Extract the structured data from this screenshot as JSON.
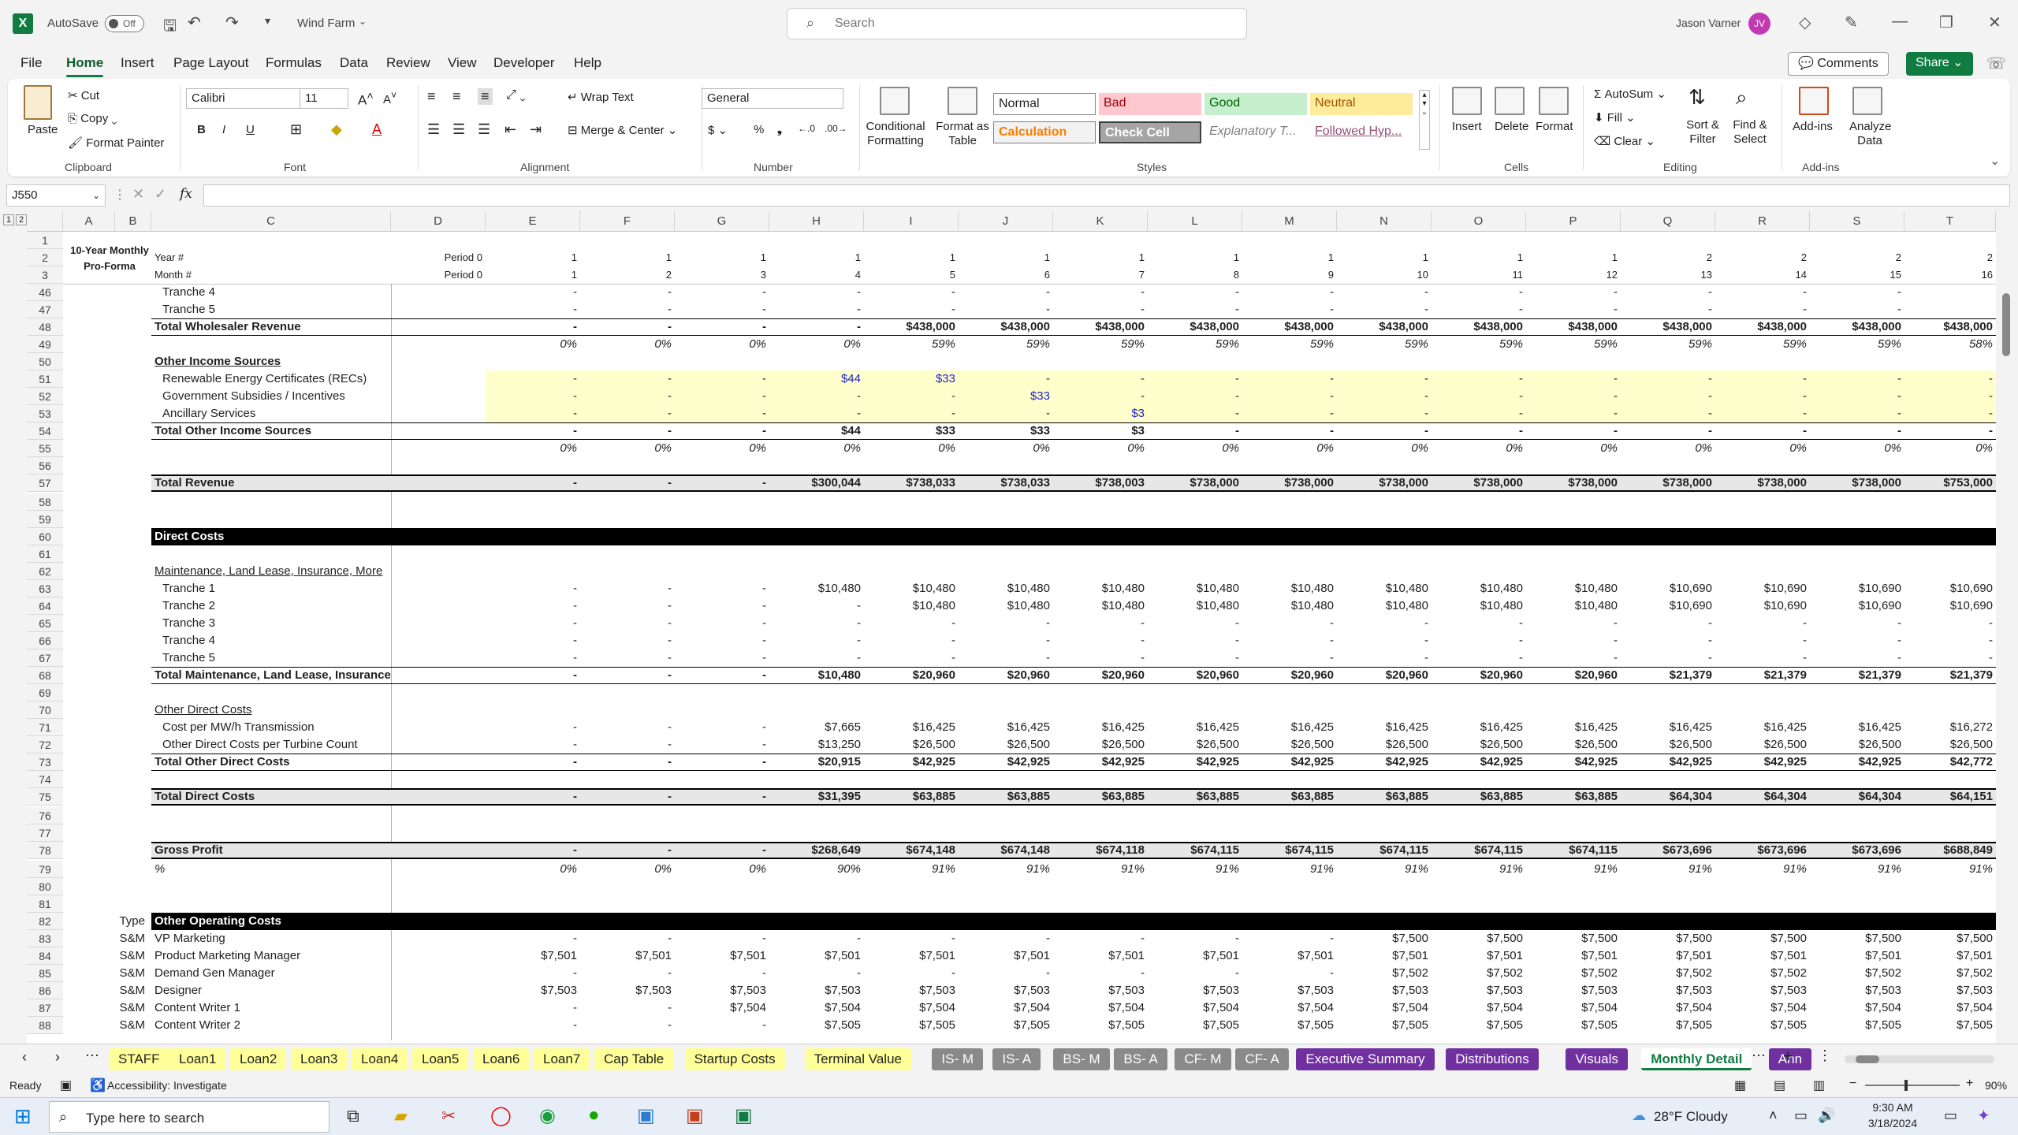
{
  "titlebar": {
    "autosave_label": "AutoSave",
    "autosave_state": "Off",
    "filename": "Wind Farm",
    "search_placeholder": "Search",
    "user_name": "Jason Varner",
    "user_initials": "JV"
  },
  "menu": [
    "File",
    "Home",
    "Insert",
    "Page Layout",
    "Formulas",
    "Data",
    "Review",
    "View",
    "Developer",
    "Help"
  ],
  "actions": {
    "comments": "Comments",
    "share": "Share"
  },
  "ribbon": {
    "clipboard": {
      "paste": "Paste",
      "cut": "Cut",
      "copy": "Copy",
      "format_painter": "Format Painter",
      "group": "Clipboard"
    },
    "font": {
      "name": "Calibri",
      "size": "11",
      "group": "Font"
    },
    "alignment": {
      "wrap": "Wrap Text",
      "merge": "Merge & Center",
      "group": "Alignment"
    },
    "number": {
      "format": "General",
      "group": "Number"
    },
    "styles": {
      "conditional": "Conditional Formatting",
      "format_table": "Format as Table",
      "cells": [
        "Normal",
        "Bad",
        "Good",
        "Neutral",
        "Calculation",
        "Check Cell",
        "Explanatory T...",
        "Followed Hyp..."
      ],
      "group": "Styles"
    },
    "cells": {
      "insert": "Insert",
      "delete": "Delete",
      "format": "Format",
      "group": "Cells"
    },
    "editing": {
      "autosum": "AutoSum",
      "fill": "Fill",
      "clear": "Clear",
      "sort": "Sort & Filter",
      "find": "Find & Select",
      "group": "Editing"
    },
    "addins": {
      "addins": "Add-ins",
      "analyze": "Analyze Data",
      "group": "Add-ins"
    }
  },
  "formula_bar": {
    "name_box": "J550",
    "formula": ""
  },
  "columns": [
    "A",
    "B",
    "C",
    "D",
    "E",
    "F",
    "G",
    "H",
    "I",
    "J",
    "K",
    "L",
    "M",
    "N",
    "O",
    "P",
    "Q",
    "R",
    "S",
    "T"
  ],
  "header_rows": [
    {
      "num": "1",
      "label": "",
      "d": "",
      "vals": []
    },
    {
      "num": "2",
      "label": "Year #",
      "d": "Period 0",
      "vals": [
        "1",
        "1",
        "1",
        "1",
        "1",
        "1",
        "1",
        "1",
        "1",
        "1",
        "1",
        "1",
        "2",
        "2",
        "2",
        "2"
      ]
    },
    {
      "num": "3",
      "label": "Month #",
      "d": "Period 0",
      "vals": [
        "1",
        "2",
        "3",
        "4",
        "5",
        "6",
        "7",
        "8",
        "9",
        "10",
        "11",
        "12",
        "13",
        "14",
        "15",
        "16"
      ]
    }
  ],
  "title_block": "10-Year Monthly Pro-Forma",
  "rows": [
    {
      "num": "46",
      "label": "Tranche 4",
      "indent": true,
      "vals": [
        "-",
        "-",
        "-",
        "-",
        "-",
        "-",
        "-",
        "-",
        "-",
        "-",
        "-",
        "-",
        "-",
        "-",
        "-"
      ]
    },
    {
      "num": "47",
      "label": "Tranche 5",
      "indent": true,
      "vals": [
        "-",
        "-",
        "-",
        "-",
        "-",
        "-",
        "-",
        "-",
        "-",
        "-",
        "-",
        "-",
        "-",
        "-",
        "-"
      ]
    },
    {
      "num": "48",
      "label": "Total Wholesaler Revenue",
      "total": true,
      "vals": [
        "-",
        "-",
        "-",
        "-",
        "$438,000",
        "$438,000",
        "$438,000",
        "$438,000",
        "$438,000",
        "$438,000",
        "$438,000",
        "$438,000",
        "$438,000",
        "$438,000",
        "$438,000",
        "$438,000"
      ]
    },
    {
      "num": "49",
      "label": "",
      "ital": true,
      "vals": [
        "0%",
        "0%",
        "0%",
        "0%",
        "59%",
        "59%",
        "59%",
        "59%",
        "59%",
        "59%",
        "59%",
        "59%",
        "59%",
        "59%",
        "59%",
        "58%"
      ]
    },
    {
      "num": "50",
      "label": "Other Income Sources",
      "section": true,
      "vals": []
    },
    {
      "num": "51",
      "label": "Renewable Energy Certificates (RECs)",
      "indent": true,
      "yellow": true,
      "vals": [
        "-",
        "-",
        "-",
        "$44",
        "$33",
        "-",
        "-",
        "-",
        "-",
        "-",
        "-",
        "-",
        "-",
        "-",
        "-",
        "-"
      ]
    },
    {
      "num": "52",
      "label": "Government Subsidies / Incentives",
      "indent": true,
      "yellow": true,
      "vals": [
        "-",
        "-",
        "-",
        "-",
        "-",
        "$33",
        "-",
        "-",
        "-",
        "-",
        "-",
        "-",
        "-",
        "-",
        "-",
        "-"
      ]
    },
    {
      "num": "53",
      "label": "Ancillary Services",
      "indent": true,
      "yellow": true,
      "vals": [
        "-",
        "-",
        "-",
        "-",
        "-",
        "-",
        "$3",
        "-",
        "-",
        "-",
        "-",
        "-",
        "-",
        "-",
        "-",
        "-"
      ]
    },
    {
      "num": "54",
      "label": "Total Other Income Sources",
      "total": true,
      "vals": [
        "-",
        "-",
        "-",
        "$44",
        "$33",
        "$33",
        "$3",
        "-",
        "-",
        "-",
        "-",
        "-",
        "-",
        "-",
        "-",
        "-"
      ]
    },
    {
      "num": "55",
      "label": "",
      "ital": true,
      "vals": [
        "0%",
        "0%",
        "0%",
        "0%",
        "0%",
        "0%",
        "0%",
        "0%",
        "0%",
        "0%",
        "0%",
        "0%",
        "0%",
        "0%",
        "0%",
        "0%"
      ]
    },
    {
      "num": "56",
      "label": "",
      "vals": []
    },
    {
      "num": "57",
      "label": "Total Revenue",
      "grand": true,
      "vals": [
        "-",
        "-",
        "-",
        "$300,044",
        "$738,033",
        "$738,033",
        "$738,003",
        "$738,000",
        "$738,000",
        "$738,000",
        "$738,000",
        "$738,000",
        "$738,000",
        "$738,000",
        "$738,000",
        "$753,000"
      ]
    },
    {
      "num": "58",
      "label": "",
      "vals": []
    },
    {
      "num": "59",
      "label": "",
      "vals": []
    },
    {
      "num": "60",
      "label": "Direct Costs",
      "black": true,
      "vals": []
    },
    {
      "num": "61",
      "label": "",
      "vals": []
    },
    {
      "num": "62",
      "label": "Maintenance, Land Lease, Insurance, More",
      "underline": true,
      "vals": []
    },
    {
      "num": "63",
      "label": "Tranche 1",
      "indent": true,
      "vals": [
        "-",
        "-",
        "-",
        "$10,480",
        "$10,480",
        "$10,480",
        "$10,480",
        "$10,480",
        "$10,480",
        "$10,480",
        "$10,480",
        "$10,480",
        "$10,690",
        "$10,690",
        "$10,690",
        "$10,690"
      ]
    },
    {
      "num": "64",
      "label": "Tranche 2",
      "indent": true,
      "vals": [
        "-",
        "-",
        "-",
        "-",
        "$10,480",
        "$10,480",
        "$10,480",
        "$10,480",
        "$10,480",
        "$10,480",
        "$10,480",
        "$10,480",
        "$10,690",
        "$10,690",
        "$10,690",
        "$10,690"
      ]
    },
    {
      "num": "65",
      "label": "Tranche 3",
      "indent": true,
      "vals": [
        "-",
        "-",
        "-",
        "-",
        "-",
        "-",
        "-",
        "-",
        "-",
        "-",
        "-",
        "-",
        "-",
        "-",
        "-",
        "-"
      ]
    },
    {
      "num": "66",
      "label": "Tranche 4",
      "indent": true,
      "vals": [
        "-",
        "-",
        "-",
        "-",
        "-",
        "-",
        "-",
        "-",
        "-",
        "-",
        "-",
        "-",
        "-",
        "-",
        "-",
        "-"
      ]
    },
    {
      "num": "67",
      "label": "Tranche 5",
      "indent": true,
      "vals": [
        "-",
        "-",
        "-",
        "-",
        "-",
        "-",
        "-",
        "-",
        "-",
        "-",
        "-",
        "-",
        "-",
        "-",
        "-",
        "-"
      ]
    },
    {
      "num": "68",
      "label": "Total Maintenance, Land Lease, Insurance",
      "total": true,
      "vals": [
        "-",
        "-",
        "-",
        "$10,480",
        "$20,960",
        "$20,960",
        "$20,960",
        "$20,960",
        "$20,960",
        "$20,960",
        "$20,960",
        "$20,960",
        "$21,379",
        "$21,379",
        "$21,379",
        "$21,379"
      ]
    },
    {
      "num": "69",
      "label": "",
      "vals": []
    },
    {
      "num": "70",
      "label": "Other Direct Costs",
      "underline": true,
      "vals": []
    },
    {
      "num": "71",
      "label": "Cost per MW/h Transmission",
      "indent": true,
      "vals": [
        "-",
        "-",
        "-",
        "$7,665",
        "$16,425",
        "$16,425",
        "$16,425",
        "$16,425",
        "$16,425",
        "$16,425",
        "$16,425",
        "$16,425",
        "$16,425",
        "$16,425",
        "$16,425",
        "$16,272"
      ]
    },
    {
      "num": "72",
      "label": "Other Direct Costs per Turbine Count",
      "indent": true,
      "vals": [
        "-",
        "-",
        "-",
        "$13,250",
        "$26,500",
        "$26,500",
        "$26,500",
        "$26,500",
        "$26,500",
        "$26,500",
        "$26,500",
        "$26,500",
        "$26,500",
        "$26,500",
        "$26,500",
        "$26,500"
      ]
    },
    {
      "num": "73",
      "label": "Total Other Direct Costs",
      "total": true,
      "vals": [
        "-",
        "-",
        "-",
        "$20,915",
        "$42,925",
        "$42,925",
        "$42,925",
        "$42,925",
        "$42,925",
        "$42,925",
        "$42,925",
        "$42,925",
        "$42,925",
        "$42,925",
        "$42,925",
        "$42,772"
      ]
    },
    {
      "num": "74",
      "label": "",
      "vals": []
    },
    {
      "num": "75",
      "label": "Total Direct Costs",
      "grand": true,
      "vals": [
        "-",
        "-",
        "-",
        "$31,395",
        "$63,885",
        "$63,885",
        "$63,885",
        "$63,885",
        "$63,885",
        "$63,885",
        "$63,885",
        "$63,885",
        "$64,304",
        "$64,304",
        "$64,304",
        "$64,151"
      ]
    },
    {
      "num": "76",
      "label": "",
      "vals": []
    },
    {
      "num": "77",
      "label": "",
      "vals": []
    },
    {
      "num": "78",
      "label": "Gross Profit",
      "grand": true,
      "vals": [
        "-",
        "-",
        "-",
        "$268,649",
        "$674,148",
        "$674,148",
        "$674,118",
        "$674,115",
        "$674,115",
        "$674,115",
        "$674,115",
        "$674,115",
        "$673,696",
        "$673,696",
        "$673,696",
        "$688,849"
      ]
    },
    {
      "num": "79",
      "label": "%",
      "ital": true,
      "vals": [
        "0%",
        "0%",
        "0%",
        "90%",
        "91%",
        "91%",
        "91%",
        "91%",
        "91%",
        "91%",
        "91%",
        "91%",
        "91%",
        "91%",
        "91%",
        "91%"
      ]
    },
    {
      "num": "80",
      "label": "",
      "vals": []
    },
    {
      "num": "81",
      "label": "",
      "vals": []
    },
    {
      "num": "82",
      "label": "Other Operating Costs",
      "black": true,
      "type": "Type",
      "vals": []
    },
    {
      "num": "83",
      "label": "VP Marketing",
      "type": "S&M",
      "vals": [
        "-",
        "-",
        "-",
        "-",
        "-",
        "-",
        "-",
        "-",
        "-",
        "$7,500",
        "$7,500",
        "$7,500",
        "$7,500",
        "$7,500",
        "$7,500",
        "$7,500"
      ]
    },
    {
      "num": "84",
      "label": "Product Marketing Manager",
      "type": "S&M",
      "vals": [
        "$7,501",
        "$7,501",
        "$7,501",
        "$7,501",
        "$7,501",
        "$7,501",
        "$7,501",
        "$7,501",
        "$7,501",
        "$7,501",
        "$7,501",
        "$7,501",
        "$7,501",
        "$7,501",
        "$7,501",
        "$7,501"
      ]
    },
    {
      "num": "85",
      "label": "Demand Gen Manager",
      "type": "S&M",
      "vals": [
        "-",
        "-",
        "-",
        "-",
        "-",
        "-",
        "-",
        "-",
        "-",
        "$7,502",
        "$7,502",
        "$7,502",
        "$7,502",
        "$7,502",
        "$7,502",
        "$7,502"
      ]
    },
    {
      "num": "86",
      "label": "Designer",
      "type": "S&M",
      "vals": [
        "$7,503",
        "$7,503",
        "$7,503",
        "$7,503",
        "$7,503",
        "$7,503",
        "$7,503",
        "$7,503",
        "$7,503",
        "$7,503",
        "$7,503",
        "$7,503",
        "$7,503",
        "$7,503",
        "$7,503",
        "$7,503"
      ]
    },
    {
      "num": "87",
      "label": "Content Writer 1",
      "type": "S&M",
      "vals": [
        "-",
        "-",
        "$7,504",
        "$7,504",
        "$7,504",
        "$7,504",
        "$7,504",
        "$7,504",
        "$7,504",
        "$7,504",
        "$7,504",
        "$7,504",
        "$7,504",
        "$7,504",
        "$7,504",
        "$7,504"
      ]
    },
    {
      "num": "88",
      "label": "Content Writer 2",
      "type": "S&M",
      "vals": [
        "-",
        "-",
        "-",
        "$7,505",
        "$7,505",
        "$7,505",
        "$7,505",
        "$7,505",
        "$7,505",
        "$7,505",
        "$7,505",
        "$7,505",
        "$7,505",
        "$7,505",
        "$7,505",
        "$7,505"
      ]
    }
  ],
  "sheet_tabs": [
    {
      "label": "STAFF",
      "style": "y"
    },
    {
      "label": "Loan1",
      "style": "y"
    },
    {
      "label": "Loan2",
      "style": "y"
    },
    {
      "label": "Loan3",
      "style": "y"
    },
    {
      "label": "Loan4",
      "style": "y"
    },
    {
      "label": "Loan5",
      "style": "y"
    },
    {
      "label": "Loan6",
      "style": "y"
    },
    {
      "label": "Loan7",
      "style": "y"
    },
    {
      "label": "Cap Table",
      "style": "y"
    },
    {
      "label": "Startup Costs",
      "style": "y"
    },
    {
      "label": "Terminal Value",
      "style": "y"
    },
    {
      "label": "IS- M",
      "style": "g"
    },
    {
      "label": "IS- A",
      "style": "g"
    },
    {
      "label": "BS- M",
      "style": "g"
    },
    {
      "label": "BS- A",
      "style": "g"
    },
    {
      "label": "CF- M",
      "style": "g"
    },
    {
      "label": "CF- A",
      "style": "g"
    },
    {
      "label": "Executive Summary",
      "style": "p"
    },
    {
      "label": "Distributions",
      "style": "p"
    },
    {
      "label": "Visuals",
      "style": "p"
    },
    {
      "label": "Monthly Detail",
      "style": "act"
    },
    {
      "label": "Ann",
      "style": "p"
    }
  ],
  "status": {
    "ready": "Ready",
    "accessibility": "Accessibility: Investigate",
    "zoom": "90%"
  },
  "taskbar": {
    "search": "Type here to search",
    "weather": "28°F  Cloudy",
    "time": "9:30 AM",
    "date": "3/18/2024"
  }
}
